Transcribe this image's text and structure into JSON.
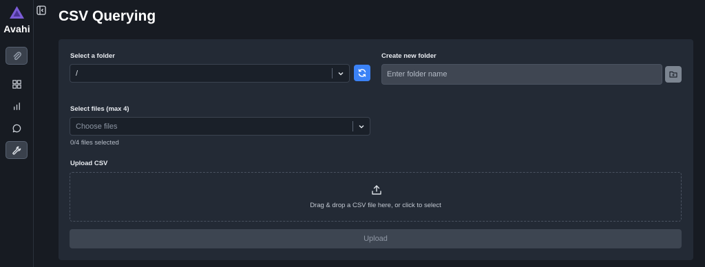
{
  "brand": {
    "name": "Avahi",
    "accent": "#7b5cd6"
  },
  "sidebar": {
    "items": [
      {
        "icon": "paperclip-icon"
      },
      {
        "icon": "grid-icon"
      },
      {
        "icon": "bar-chart-icon"
      },
      {
        "icon": "chat-bubble-icon"
      },
      {
        "icon": "wrench-icon"
      }
    ]
  },
  "page": {
    "title": "CSV Querying"
  },
  "folder_select": {
    "label": "Select a folder",
    "value": "/"
  },
  "new_folder": {
    "label": "Create new folder",
    "placeholder": "Enter folder name"
  },
  "files_select": {
    "label": "Select files (max 4)",
    "placeholder": "Choose files",
    "count_text": "0/4 files selected"
  },
  "upload": {
    "label": "Upload CSV",
    "drop_text": "Drag & drop a CSV file here, or click to select",
    "button_label": "Upload"
  },
  "colors": {
    "primary": "#3b82f6",
    "background": "#171b22",
    "card": "#232a35"
  }
}
